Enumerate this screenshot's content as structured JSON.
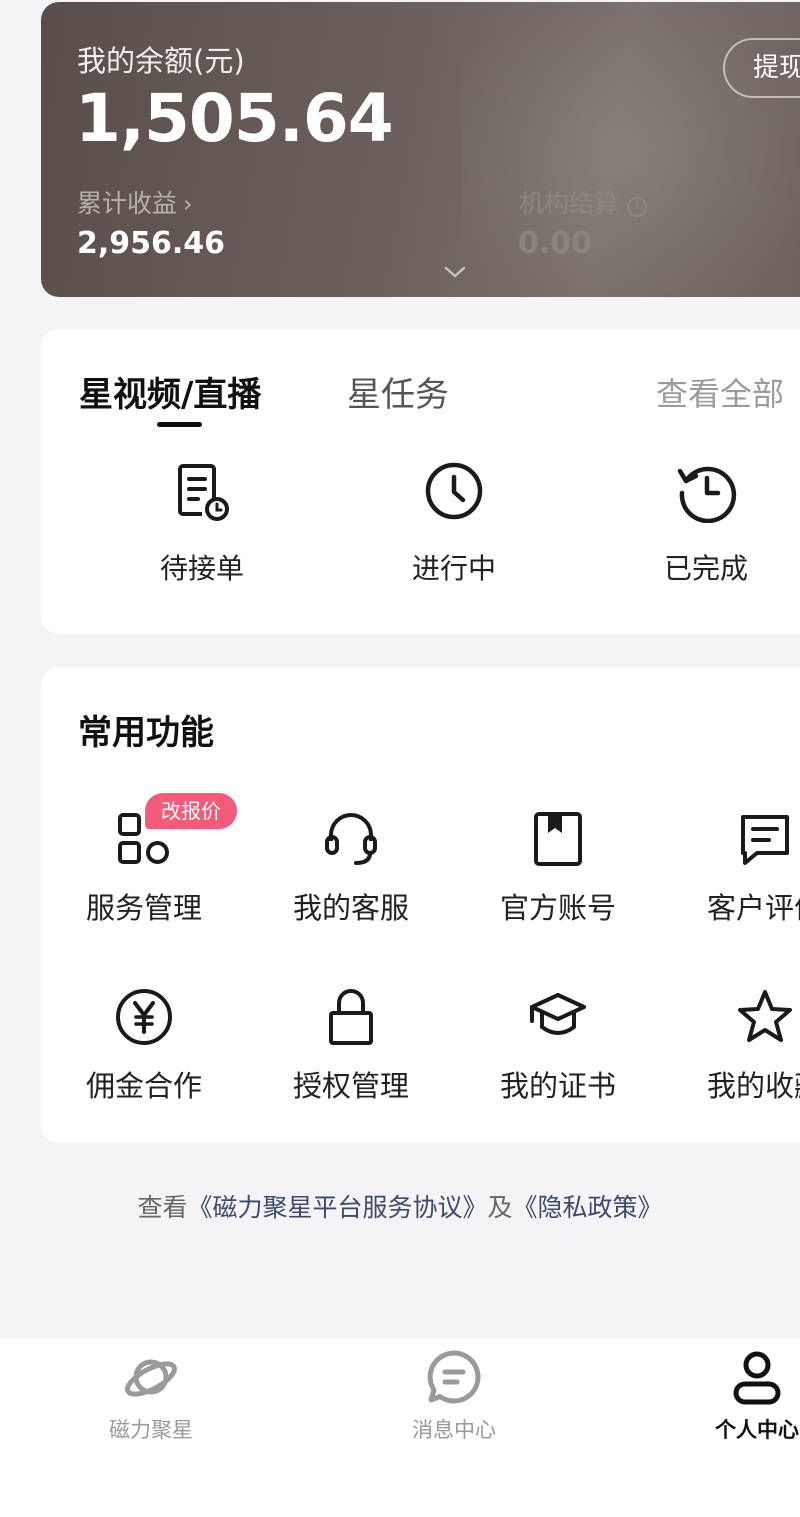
{
  "balance": {
    "label": "我的余额(元)",
    "amount": "1,505.64",
    "withdraw_label": "提现",
    "cumulative_label": "累计收益",
    "cumulative_chevron": "›",
    "cumulative_value": "2,956.46",
    "institution_label": "机构结算",
    "institution_info_glyph": "i",
    "institution_value": "0.00"
  },
  "orders": {
    "tabs": [
      {
        "label": "星视频/直播",
        "active": true
      },
      {
        "label": "星任务",
        "active": false
      }
    ],
    "view_all": "查看全部",
    "statuses": [
      {
        "label": "待接单",
        "icon": "pending-order-icon"
      },
      {
        "label": "进行中",
        "icon": "clock-icon"
      },
      {
        "label": "已完成",
        "icon": "history-icon"
      }
    ]
  },
  "functions": {
    "title": "常用功能",
    "badge": "改报价",
    "items": [
      {
        "label": "服务管理",
        "icon": "grid-apps-icon"
      },
      {
        "label": "我的客服",
        "icon": "headset-icon"
      },
      {
        "label": "官方账号",
        "icon": "bookmark-book-icon"
      },
      {
        "label": "客户评价",
        "icon": "comment-icon"
      },
      {
        "label": "佣金合作",
        "icon": "yen-coin-icon"
      },
      {
        "label": "授权管理",
        "icon": "lock-icon"
      },
      {
        "label": "我的证书",
        "icon": "graduation-cap-icon"
      },
      {
        "label": "我的收藏",
        "icon": "star-icon"
      }
    ]
  },
  "agreement": {
    "prefix": "查看",
    "service_link": "《磁力聚星平台服务协议》",
    "conjunction": "及",
    "privacy_link": "《隐私政策》"
  },
  "nav": {
    "items": [
      {
        "label": "磁力聚星",
        "icon": "planet-icon",
        "active": false
      },
      {
        "label": "消息中心",
        "icon": "message-icon",
        "active": false
      },
      {
        "label": "个人中心",
        "icon": "person-icon",
        "active": true
      }
    ]
  },
  "colors": {
    "badge": "#f25c7a",
    "link": "#3d4b6b",
    "card_bg": "#ffffff",
    "page_bg": "#f4f4f6"
  }
}
